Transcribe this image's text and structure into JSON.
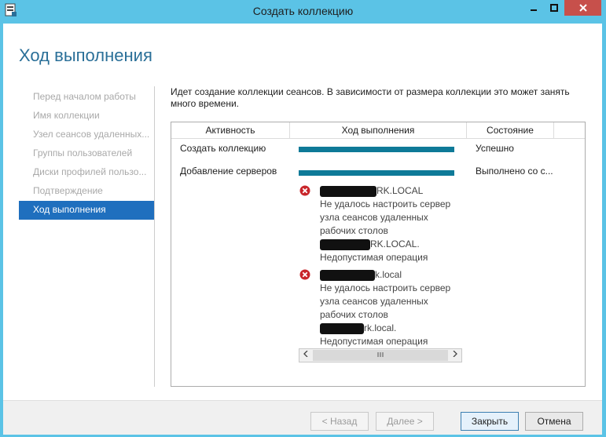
{
  "window": {
    "title": "Создать коллекцию",
    "accent_color": "#5bc3e6",
    "close_color": "#c7504b"
  },
  "header": {
    "page_title": "Ход выполнения"
  },
  "nav": {
    "items": [
      {
        "label": "Перед началом работы",
        "active": false
      },
      {
        "label": "Имя коллекции",
        "active": false
      },
      {
        "label": "Узел сеансов удаленных...",
        "active": false
      },
      {
        "label": "Группы пользователей",
        "active": false
      },
      {
        "label": "Диски профилей пользо...",
        "active": false
      },
      {
        "label": "Подтверждение",
        "active": false
      },
      {
        "label": "Ход выполнения",
        "active": true
      }
    ]
  },
  "main": {
    "description": "Идет создание коллекции сеансов. В зависимости от размера коллекции это может занять много времени.",
    "table": {
      "columns": [
        "Активность",
        "Ход выполнения",
        "Состояние"
      ],
      "rows": [
        {
          "activity": "Создать коллекцию",
          "progress": 1.0,
          "status": "Успешно"
        },
        {
          "activity": "Добавление серверов",
          "progress": 1.0,
          "status": "Выполнено со с..."
        }
      ],
      "errors": [
        {
          "host_suffix": "RK.LOCAL",
          "message_lines": [
            "Не удалось настроить сервер",
            "узла сеансов удаленных",
            "рабочих столов"
          ],
          "host2_suffix": "RK.LOCAL.",
          "detail": "Недопустимая операция"
        },
        {
          "host_suffix": "k.local",
          "message_lines": [
            "Не удалось настроить сервер",
            "узла сеансов удаленных",
            "рабочих столов"
          ],
          "host2_suffix": "rk.local.",
          "detail": "Недопустимая операция"
        }
      ]
    }
  },
  "footer": {
    "back_label": "< Назад",
    "next_label": "Далее >",
    "close_label": "Закрыть",
    "cancel_label": "Отмена"
  }
}
